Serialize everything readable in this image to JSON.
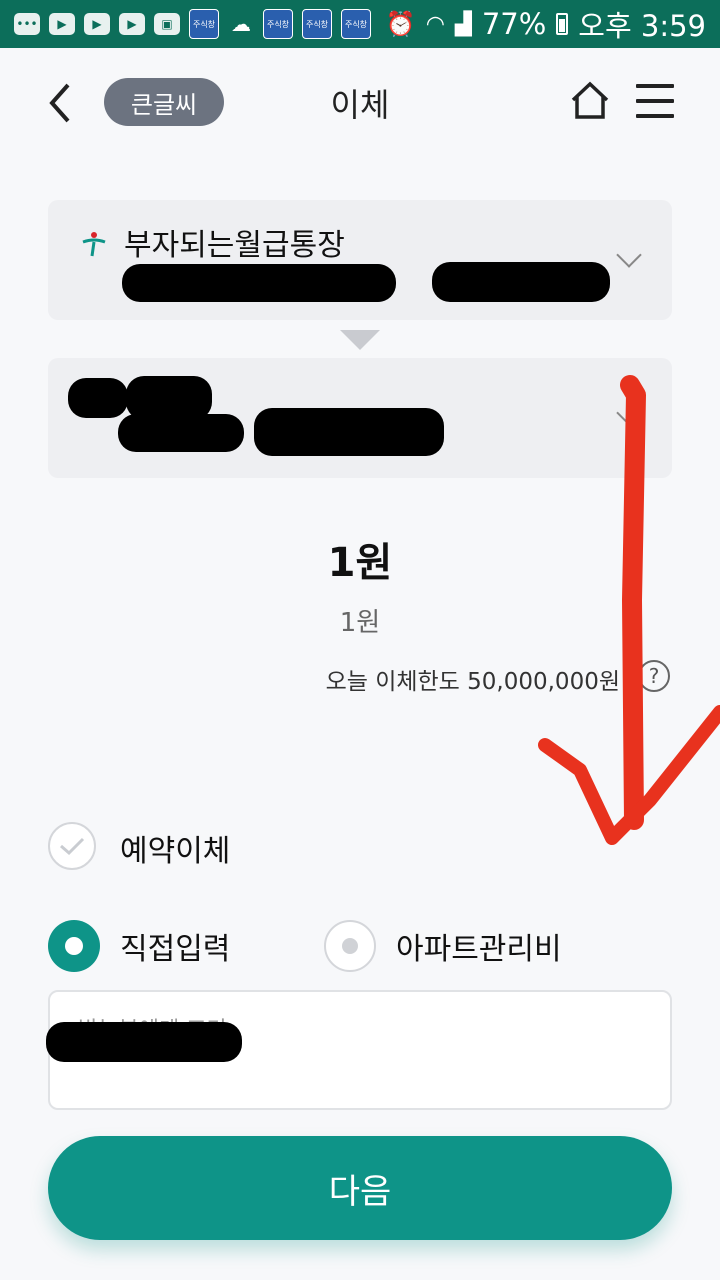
{
  "status_bar": {
    "battery": "77%",
    "time": "오후 3:59",
    "app_badge": "주식창"
  },
  "header": {
    "back_icon": "chevron-left-icon",
    "big_text_label": "큰글씨",
    "title": "이체",
    "home_icon": "home-icon",
    "menu_icon": "menu-icon"
  },
  "from_account": {
    "name": "부자되는월급통장",
    "expand_icon": "chevron-down-icon"
  },
  "to_account": {
    "expand_icon": "chevron-down-icon"
  },
  "amount": {
    "main": "1원",
    "sub": "1원",
    "limit": "오늘 이체한도 50,000,000원",
    "help_icon": "question-icon",
    "help_glyph": "?"
  },
  "options": {
    "reserve_label": "예약이체",
    "reserve_checked": false,
    "direct_label": "직접입력",
    "apartment_label": "아파트관리비",
    "selected": "직접입력"
  },
  "memo": {
    "label": "받는분에게 표기"
  },
  "next_button": {
    "label": "다음"
  },
  "colors": {
    "status_bar": "#0c6e5a",
    "accent": "#0e9488",
    "annotation": "#e8321e"
  }
}
